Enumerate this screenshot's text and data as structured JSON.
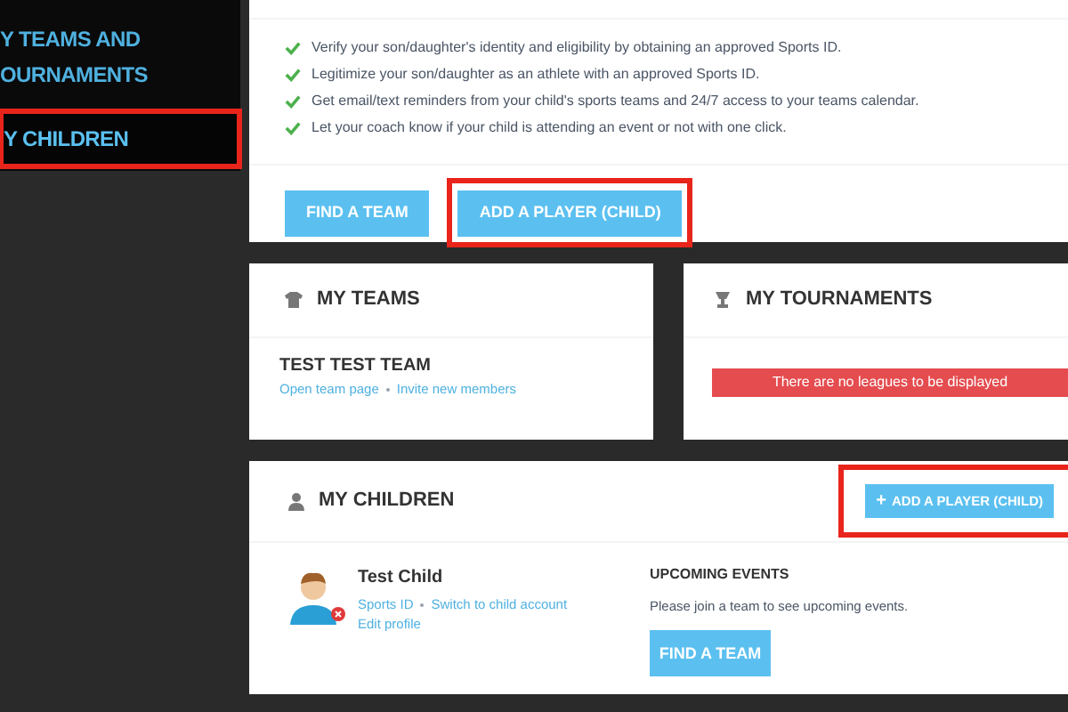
{
  "sidebar": {
    "items": [
      {
        "lines": [
          "Y TEAMS AND",
          "OURNAMENTS"
        ],
        "selected": false,
        "highlighted": false
      },
      {
        "lines": [
          "Y CHILDREN"
        ],
        "selected": true,
        "highlighted": true
      }
    ]
  },
  "intro": {
    "benefits": [
      "Verify your son/daughter's identity and eligibility by obtaining an approved Sports ID.",
      "Legitimize your son/daughter as an athlete with an approved Sports ID.",
      "Get email/text reminders from your child's sports teams and 24/7 access to your teams calendar.",
      "Let your coach know if your child is attending an event or not with one click."
    ],
    "buttons": [
      {
        "label": "FIND A TEAM",
        "highlighted": false
      },
      {
        "label": "ADD A PLAYER (CHILD)",
        "highlighted": true
      }
    ]
  },
  "my_teams": {
    "title": "MY TEAMS",
    "teams": [
      {
        "name": "TEST TEST TEAM",
        "links": [
          "Open team page",
          "Invite new members"
        ]
      }
    ]
  },
  "my_tournaments": {
    "title": "MY TOURNAMENTS",
    "alert": "There are no leagues to be displayed"
  },
  "my_children": {
    "title": "MY CHILDREN",
    "add_button": {
      "icon": "+",
      "label": "ADD A PLAYER (CHILD)",
      "highlighted": true
    },
    "children": [
      {
        "name": "Test Child",
        "links": [
          "Sports ID",
          "Switch to child account"
        ],
        "edit_link": "Edit profile"
      }
    ],
    "upcoming": {
      "title": "UPCOMING EVENTS",
      "message": "Please join a team to see upcoming events.",
      "button": "FIND A TEAM"
    }
  }
}
